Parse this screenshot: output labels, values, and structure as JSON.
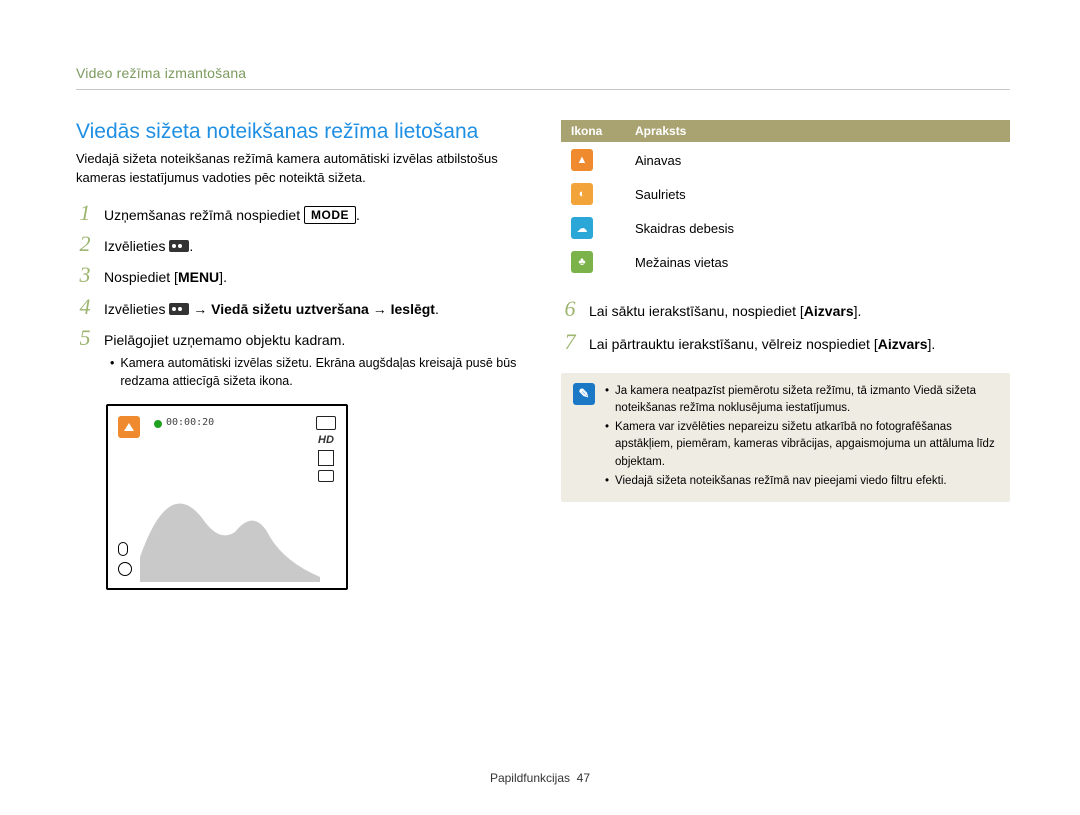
{
  "header": {
    "breadcrumb": "Video režīma izmantošana"
  },
  "title": "Viedās sižeta noteikšanas režīma lietošana",
  "intro": "Viedajā sižeta noteikšanas režīmā kamera automātiski izvēlas atbilstošus kameras iestatījumus vadoties pēc noteiktā sižeta.",
  "steps": {
    "s1_pre": "Uzņemšanas režīmā nospiediet ",
    "s1_btn": "MODE",
    "s1_post": ".",
    "s2": "Izvēlieties ",
    "s2_post": ".",
    "s3_pre": "Nospiediet ",
    "s3_btn": "MENU",
    "s3_post": ".",
    "s4_pre": "Izvēlieties ",
    "s4_bold": " → Viedā sižetu uztveršana → Ieslēgt",
    "s4_post": ".",
    "s5": "Pielāgojiet uzņemamo objektu kadram.",
    "s5_sub": "Kamera automātiski izvēlas sižetu. Ekrāna augšdaļas kreisajā pusē būs redzama attiecīgā sižeta ikona.",
    "s6_pre": "Lai sāktu ierakstīšanu, nospiediet [",
    "s6_bold": "Aizvars",
    "s6_post": "].",
    "s7_pre": "Lai pārtrauktu ierakstīšanu, vēlreiz nospiediet [",
    "s7_bold": "Aizvars",
    "s7_post": "]."
  },
  "screen": {
    "timecode": "00:00:20",
    "hd": "HD"
  },
  "table": {
    "h_icon": "Ikona",
    "h_desc": "Apraksts",
    "rows": [
      {
        "color": "#ef8b2e",
        "label": "Ainavas"
      },
      {
        "color": "#f2a33a",
        "label": "Saulriets"
      },
      {
        "color": "#2aa7d6",
        "label": "Skaidras debesis"
      },
      {
        "color": "#7bb24a",
        "label": "Mežainas vietas"
      }
    ]
  },
  "notes": [
    "Ja kamera neatpazīst piemērotu sižeta režīmu, tā izmanto Viedā sižeta noteikšanas režīma noklusējuma iestatījumus.",
    "Kamera var izvēlēties nepareizu sižetu atkarībā no fotografēšanas apstākļiem, piemēram, kameras vibrācijas, apgaismojuma un attāluma līdz objektam.",
    "Viedajā sižeta noteikšanas režīmā nav pieejami viedo filtru efekti."
  ],
  "footer": {
    "section": "Papildfunkcijas",
    "page": "47"
  }
}
